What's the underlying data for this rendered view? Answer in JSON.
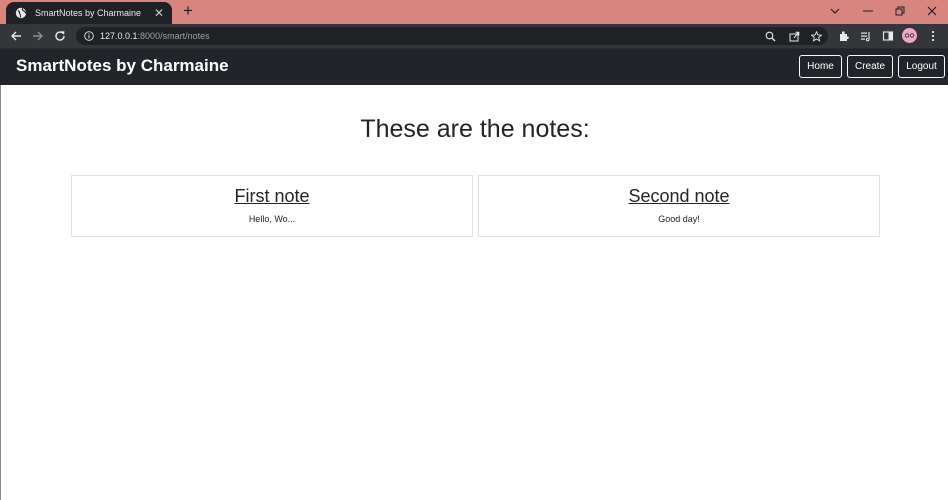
{
  "browser": {
    "tab_title": "SmartNotes by Charmaine",
    "url_host": "127.0.0.1",
    "url_path": ":8000/smart/notes",
    "tabstrip_color": "#d9857f"
  },
  "navbar": {
    "brand": "SmartNotes by Charmaine",
    "buttons": [
      {
        "label": "Home"
      },
      {
        "label": "Create"
      },
      {
        "label": "Logout"
      }
    ]
  },
  "main": {
    "heading": "These are the notes:",
    "notes": [
      {
        "title": "First note",
        "preview": "Hello, Wo..."
      },
      {
        "title": "Second note",
        "preview": "Good day!"
      }
    ]
  },
  "icons": {
    "tab": "globe-icon",
    "toolbar": [
      "back-icon",
      "forward-icon",
      "reload-icon",
      "info-icon",
      "zoom-icon",
      "share-icon",
      "bookmark-star-icon",
      "extensions-icon",
      "reading-list-icon",
      "side-panel-icon",
      "menu-icon"
    ]
  }
}
